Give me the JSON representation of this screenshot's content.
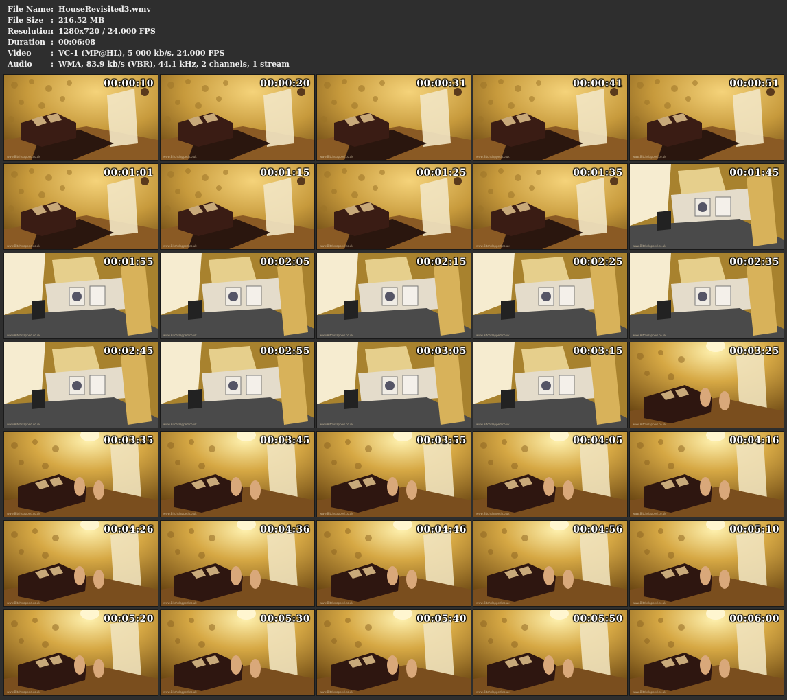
{
  "info": [
    {
      "label": "File Name",
      "value": "HouseRevisited3.wmv"
    },
    {
      "label": "File Size",
      "value": "216.52 MB"
    },
    {
      "label": "Resolution",
      "value": "1280x720 / 24.000 FPS"
    },
    {
      "label": "Duration",
      "value": "00:06:08"
    },
    {
      "label": "Video",
      "value": "VC-1 (MP@HL), 5 000 kb/s, 24.000 FPS"
    },
    {
      "label": "Audio",
      "value": "WMA, 83.9 kb/s (VBR), 44.1 kHz, 2 channels, 1 stream"
    }
  ],
  "separator": ":",
  "watermark": "www.Bitchslapped.co.uk",
  "thumbnails": [
    {
      "time": "00:00:10",
      "scene": "living"
    },
    {
      "time": "00:00:20",
      "scene": "living"
    },
    {
      "time": "00:00:31",
      "scene": "living"
    },
    {
      "time": "00:00:41",
      "scene": "living"
    },
    {
      "time": "00:00:51",
      "scene": "living"
    },
    {
      "time": "00:01:01",
      "scene": "living"
    },
    {
      "time": "00:01:15",
      "scene": "living"
    },
    {
      "time": "00:01:25",
      "scene": "living"
    },
    {
      "time": "00:01:35",
      "scene": "living"
    },
    {
      "time": "00:01:45",
      "scene": "kitchen"
    },
    {
      "time": "00:01:55",
      "scene": "kitchen"
    },
    {
      "time": "00:02:05",
      "scene": "kitchen"
    },
    {
      "time": "00:02:15",
      "scene": "kitchen"
    },
    {
      "time": "00:02:25",
      "scene": "kitchen"
    },
    {
      "time": "00:02:35",
      "scene": "kitchen"
    },
    {
      "time": "00:02:45",
      "scene": "kitchen"
    },
    {
      "time": "00:02:55",
      "scene": "kitchen"
    },
    {
      "time": "00:03:05",
      "scene": "kitchen"
    },
    {
      "time": "00:03:15",
      "scene": "kitchen"
    },
    {
      "time": "00:03:25",
      "scene": "lounge"
    },
    {
      "time": "00:03:35",
      "scene": "lounge"
    },
    {
      "time": "00:03:45",
      "scene": "lounge"
    },
    {
      "time": "00:03:55",
      "scene": "lounge"
    },
    {
      "time": "00:04:05",
      "scene": "lounge"
    },
    {
      "time": "00:04:16",
      "scene": "lounge"
    },
    {
      "time": "00:04:26",
      "scene": "lounge"
    },
    {
      "time": "00:04:36",
      "scene": "lounge"
    },
    {
      "time": "00:04:46",
      "scene": "lounge"
    },
    {
      "time": "00:04:56",
      "scene": "lounge"
    },
    {
      "time": "00:05:10",
      "scene": "lounge"
    },
    {
      "time": "00:05:20",
      "scene": "lounge"
    },
    {
      "time": "00:05:30",
      "scene": "lounge"
    },
    {
      "time": "00:05:40",
      "scene": "lounge"
    },
    {
      "time": "00:05:50",
      "scene": "lounge"
    },
    {
      "time": "00:06:00",
      "scene": "lounge"
    }
  ]
}
